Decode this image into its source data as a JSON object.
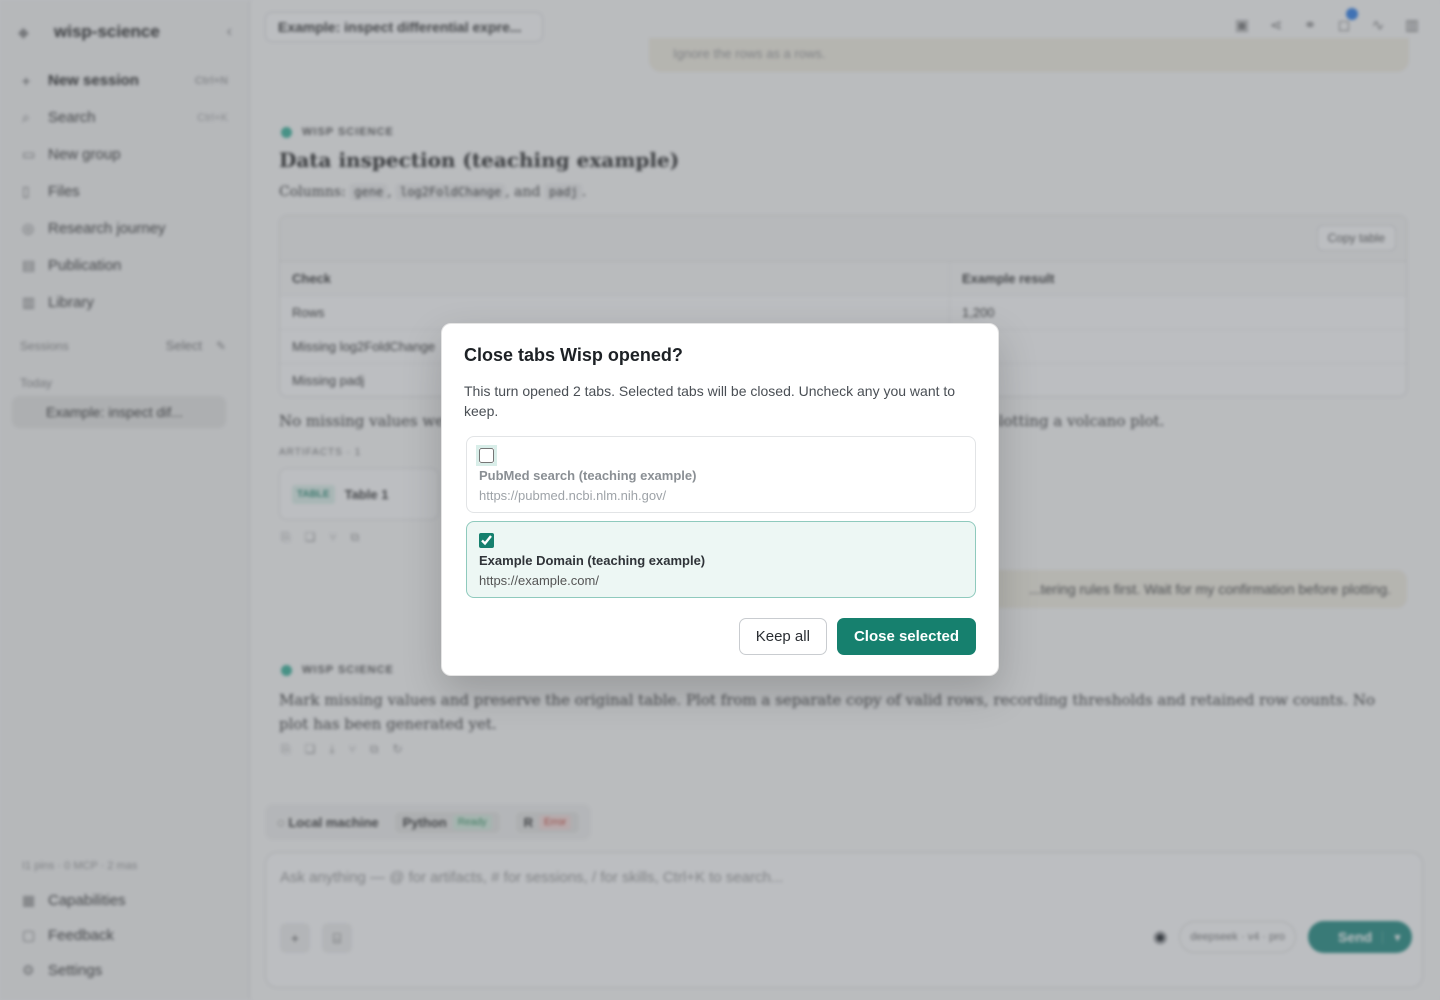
{
  "sidebar": {
    "brand": "wisp-science",
    "nav": [
      {
        "label": "New session",
        "shortcut": "Ctrl+N",
        "icon": "plus-icon"
      },
      {
        "label": "Search",
        "shortcut": "Ctrl+K",
        "icon": "search-icon"
      },
      {
        "label": "New group",
        "shortcut": "",
        "icon": "folder-icon"
      },
      {
        "label": "Files",
        "shortcut": "",
        "icon": "file-icon"
      },
      {
        "label": "Research journey",
        "shortcut": "",
        "icon": "journey-icon"
      },
      {
        "label": "Publication",
        "shortcut": "",
        "icon": "publication-icon"
      },
      {
        "label": "Library",
        "shortcut": "",
        "icon": "library-icon"
      }
    ],
    "sessions_label": "Sessions",
    "select_label": "Select",
    "today_label": "Today",
    "session_item": "Example: inspect dif...",
    "usage": "I1 pins · 0 MCP · 2 mas",
    "bottom_nav": [
      {
        "label": "Capabilities",
        "icon": "capabilities-icon"
      },
      {
        "label": "Feedback",
        "icon": "feedback-icon"
      },
      {
        "label": "Settings",
        "icon": "gear-icon"
      }
    ]
  },
  "main": {
    "tab_title": "Example: inspect differential expre...",
    "prev_bubble": "Ignore the rows as a rows.",
    "assistant_label": "WISP SCIENCE",
    "heading": "Data inspection (teaching example)",
    "columns_prefix": "Columns: ",
    "columns": [
      "gene",
      "log2FoldChange",
      "padj"
    ],
    "copy_table": "Copy table",
    "table": {
      "headers": [
        "Check",
        "Example result"
      ],
      "rows": [
        [
          "Rows",
          "1,200"
        ],
        [
          "Missing log2FoldChange",
          ""
        ],
        [
          "Missing padj",
          ""
        ]
      ]
    },
    "para_left": "No missing values were",
    "para_right": "plotting a volcano plot.",
    "artifacts_label": "ARTIFACTS · 1",
    "artifact_badge": "TABLE",
    "artifact_name": "Table 1",
    "user_bubble": "...tering rules first. Wait for my confirmation before plotting.",
    "mark_para": "Mark missing values and preserve the original table. Plot from a separate copy of valid rows, recording thresholds and retained row counts. No plot has been generated yet.",
    "env": {
      "local": "Local machine",
      "python": "Python",
      "python_status": "Ready",
      "r": "R",
      "r_status": "Error"
    },
    "composer_placeholder": "Ask anything — @ for artifacts, # for sessions, / for skills, Ctrl+K to search...",
    "model": "deepseek · v4 · pro",
    "send": "Send"
  },
  "modal": {
    "title": "Close tabs Wisp opened?",
    "description": "This turn opened 2 tabs. Selected tabs will be closed. Uncheck any you want to keep.",
    "tabs": [
      {
        "name": "PubMed search (teaching example)",
        "url": "https://pubmed.ncbi.nlm.nih.gov/",
        "checked": false
      },
      {
        "name": "Example Domain (teaching example)",
        "url": "https://example.com/",
        "checked": true
      }
    ],
    "keep_all": "Keep all",
    "close_selected": "Close selected"
  },
  "colors": {
    "accent": "#16806e",
    "overlay": "rgba(95,100,108,0.42)"
  }
}
